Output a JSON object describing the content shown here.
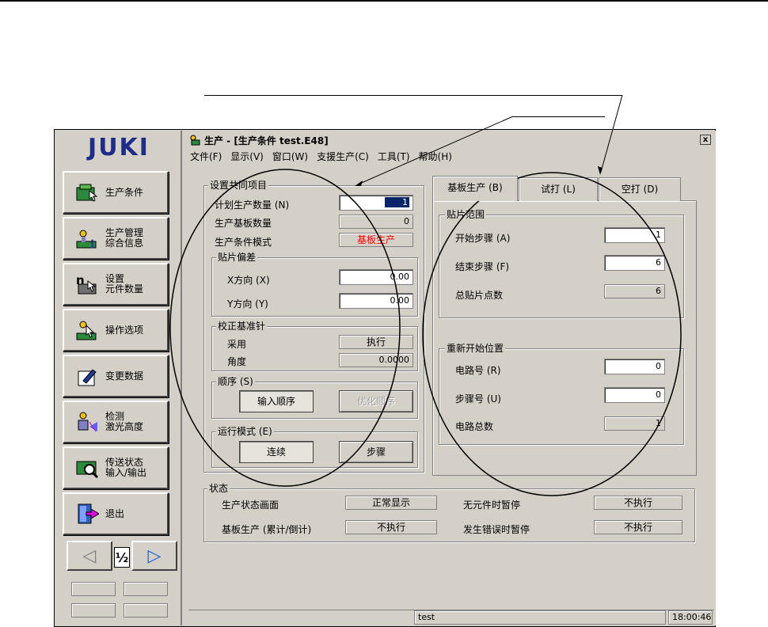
{
  "window": {
    "title": "生产 - [生产条件 test.E48]",
    "close_glyph": "x"
  },
  "menu": [
    "文件(F)",
    "显示(V)",
    "窗口(W)",
    "支援生产(C)",
    "工具(T)",
    "帮助(H)"
  ],
  "sidebar": {
    "logo": "JUKI",
    "items": [
      {
        "label": "生产条件",
        "icon": "production-condition-icon"
      },
      {
        "label": "生产管理\n综合信息",
        "icon": "management-info-icon"
      },
      {
        "label": "设置\n元件数量",
        "icon": "component-count-icon"
      },
      {
        "label": "操作选项",
        "icon": "operation-options-icon"
      },
      {
        "label": "变更数据",
        "icon": "edit-data-icon"
      },
      {
        "label": "检测\n激光高度",
        "icon": "laser-height-icon"
      },
      {
        "label": "传送状态\n输入/输出",
        "icon": "transfer-io-icon"
      },
      {
        "label": "退出",
        "icon": "exit-icon"
      }
    ],
    "pager": {
      "prev": "◁",
      "page": "½",
      "next": "▷"
    }
  },
  "common": {
    "title": "设置共同项目",
    "planned_qty_label": "计划生产数量 (N)",
    "planned_qty_value": "1",
    "produced_qty_label": "生产基板数量",
    "produced_qty_value": "0",
    "mode_label": "生产条件模式",
    "mode_value": "基板生产",
    "mode_color": "#ff0000",
    "offset": {
      "title": "贴片偏差",
      "x_label": "X方向 (X)",
      "x_value": "0.00",
      "y_label": "Y方向 (Y)",
      "y_value": "0.00"
    },
    "calib": {
      "title": "校正基准针",
      "use_label": "采用",
      "use_value": "执行",
      "angle_label": "角度",
      "angle_value": "0.0000"
    },
    "order": {
      "title": "顺序 (S)",
      "input_btn": "输入顺序",
      "optimize_btn": "优化顺序"
    },
    "run_mode": {
      "title": "运行模式 (E)",
      "continuous_btn": "连续",
      "step_btn": "步骤"
    }
  },
  "tabs": [
    "基板生产 (B)",
    "试打 (L)",
    "空打 (D)"
  ],
  "placement_range": {
    "title": "贴片范围",
    "start_label": "开始步骤 (A)",
    "start_value": "1",
    "end_label": "结束步骤 (F)",
    "end_value": "6",
    "total_label": "总贴片点数",
    "total_value": "6"
  },
  "restart": {
    "title": "重新开始位置",
    "circuit_label": "电路号 (R)",
    "circuit_value": "0",
    "step_label": "步骤号 (U)",
    "step_value": "0",
    "circuit_total_label": "电路总数",
    "circuit_total_value": "1"
  },
  "status": {
    "title": "状态",
    "screen_label": "生产状态画面",
    "screen_value": "正常显示",
    "board_label": "基板生产 (累计/倒计)",
    "board_value": "不执行",
    "no_part_label": "无元件时暂停",
    "no_part_value": "不执行",
    "error_label": "发生错误时暂停",
    "error_value": "不执行"
  },
  "statusbar": {
    "text": "test",
    "time": "18:00:46"
  }
}
